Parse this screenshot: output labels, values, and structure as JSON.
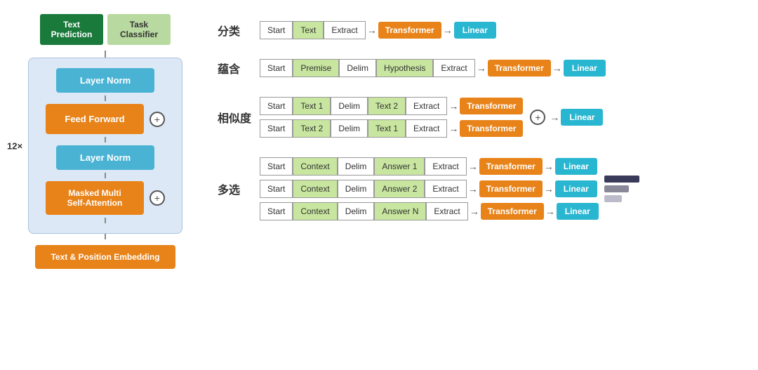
{
  "left": {
    "text_prediction": "Text\nPrediction",
    "task_classifier": "Task\nClassifier",
    "layer_norm_top": "Layer Norm",
    "feed_forward": "Feed Forward",
    "layer_norm_bottom": "Layer Norm",
    "masked_attn": "Masked Multi\nSelf-Attention",
    "embedding": "Text & Position Embedding",
    "multiplier": "12×"
  },
  "right": {
    "tasks": [
      {
        "label": "分类",
        "rows": [
          {
            "tokens": [
              "Start",
              "Text",
              "Extract"
            ],
            "has_transformer": true,
            "has_linear": true
          }
        ]
      },
      {
        "label": "蕴含",
        "rows": [
          {
            "tokens": [
              "Start",
              "Premise",
              "Delim",
              "Hypothesis",
              "Extract"
            ],
            "has_transformer": true,
            "has_linear": true
          }
        ]
      },
      {
        "label": "相似度",
        "rows": [
          {
            "tokens": [
              "Start",
              "Text 1",
              "Delim",
              "Text 2",
              "Extract"
            ],
            "has_transformer": true,
            "has_linear": false
          },
          {
            "tokens": [
              "Start",
              "Text 2",
              "Delim",
              "Text 1",
              "Extract"
            ],
            "has_transformer": true,
            "has_linear": false
          }
        ],
        "combined_linear": true
      },
      {
        "label": "多选",
        "rows": [
          {
            "tokens": [
              "Start",
              "Context",
              "Delim",
              "Answer 1",
              "Extract"
            ],
            "has_transformer": true,
            "has_linear": true
          },
          {
            "tokens": [
              "Start",
              "Context",
              "Delim",
              "Answer 2",
              "Extract"
            ],
            "has_transformer": true,
            "has_linear": true
          },
          {
            "tokens": [
              "Start",
              "Context",
              "Delim",
              "Answer N",
              "Extract"
            ],
            "has_transformer": true,
            "has_linear": true
          }
        ],
        "has_mc_bar": true
      }
    ],
    "transformer_label": "Transformer",
    "linear_label": "Linear",
    "colors": {
      "green_token": "#c8e6a0",
      "orange": "#e8831a",
      "blue_linear": "#29b6d0",
      "mc_bar1": "#555577",
      "mc_bar2": "#aaaacc",
      "mc_bar3": "#ccccdd"
    }
  }
}
